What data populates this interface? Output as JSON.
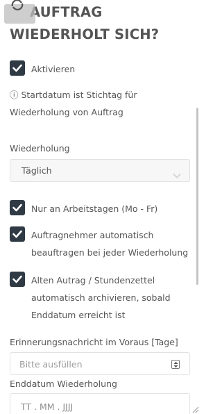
{
  "title": {
    "line1": "AUFTRAG",
    "line2": "WIEDERHOLT SICH?"
  },
  "activate": {
    "label": "Aktivieren",
    "checked": true
  },
  "info": {
    "text": "ⓘ Startdatum ist Stichtag für Wiederholung von Auftrag"
  },
  "repeat": {
    "label": "Wiederholung",
    "value": "Täglich"
  },
  "options": [
    {
      "label": "Nur an Arbeitstagen (Mo - Fr)",
      "checked": true
    },
    {
      "label": "Auftragnehmer automatisch beauftragen bei jeder Wiederholung",
      "checked": true
    },
    {
      "label": "Alten Autrag / Stundenzettel automatisch archivieren, sobald Enddatum erreicht ist",
      "checked": true
    }
  ],
  "reminder": {
    "label": "Erinnerungsnachricht im Voraus [Tage]",
    "placeholder": "Bitte ausfüllen"
  },
  "end_date": {
    "label": "Enddatum Wiederholung",
    "placeholder": "TT . MM . JJJJ"
  },
  "colors": {
    "checkbox": "#2f3a44",
    "text": "#555555",
    "field_border": "#e2e2e2"
  }
}
